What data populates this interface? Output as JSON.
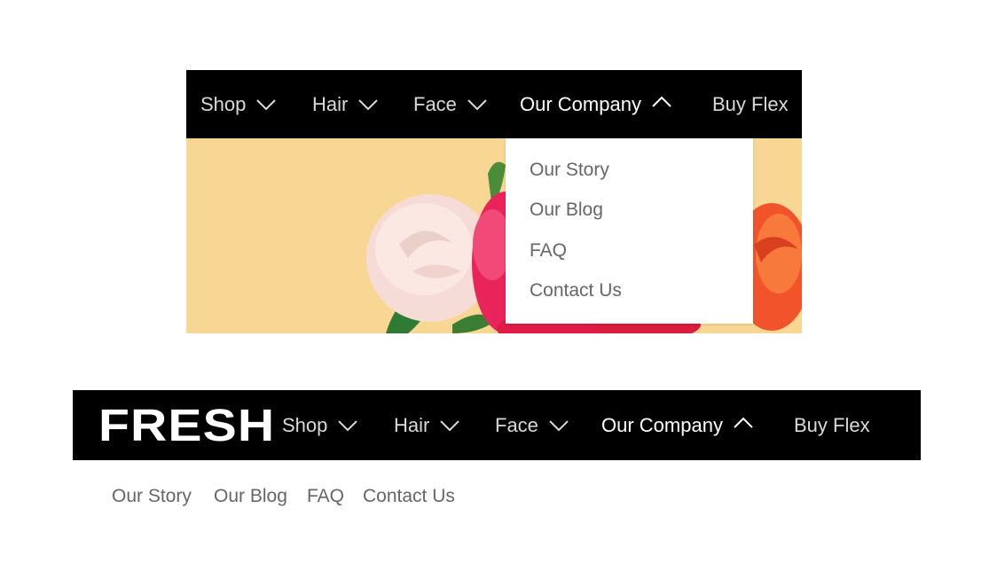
{
  "top_mockup": {
    "nav": {
      "items": [
        {
          "label": "Shop",
          "icon": "chevron-down-icon"
        },
        {
          "label": "Hair",
          "icon": "chevron-down-icon"
        },
        {
          "label": "Face",
          "icon": "chevron-down-icon"
        },
        {
          "label": "Our Company",
          "icon": "chevron-up-icon",
          "active": true
        },
        {
          "label": "Buy Flex"
        }
      ]
    },
    "dropdown": {
      "items": [
        "Our Story",
        "Our Blog",
        "FAQ",
        "Contact Us"
      ]
    },
    "hero_image": {
      "content": "roses-photo",
      "background_color": "#f8d694"
    }
  },
  "bottom_mockup": {
    "logo_text": "FRESH",
    "nav": {
      "items": [
        {
          "label": "Shop",
          "icon": "chevron-down-icon"
        },
        {
          "label": "Hair",
          "icon": "chevron-down-icon"
        },
        {
          "label": "Face",
          "icon": "chevron-down-icon"
        },
        {
          "label": "Our Company",
          "icon": "chevron-up-icon",
          "active": true
        },
        {
          "label": "Buy Flex"
        }
      ]
    },
    "subnav": {
      "items": [
        "Our Story",
        "Our Blog",
        "FAQ",
        "Contact Us"
      ]
    }
  },
  "colors": {
    "nav_background": "#000000",
    "nav_text": "#d9d9d9",
    "nav_active_text": "#ffffff",
    "submenu_text": "#666666",
    "page_background": "#ffffff"
  }
}
